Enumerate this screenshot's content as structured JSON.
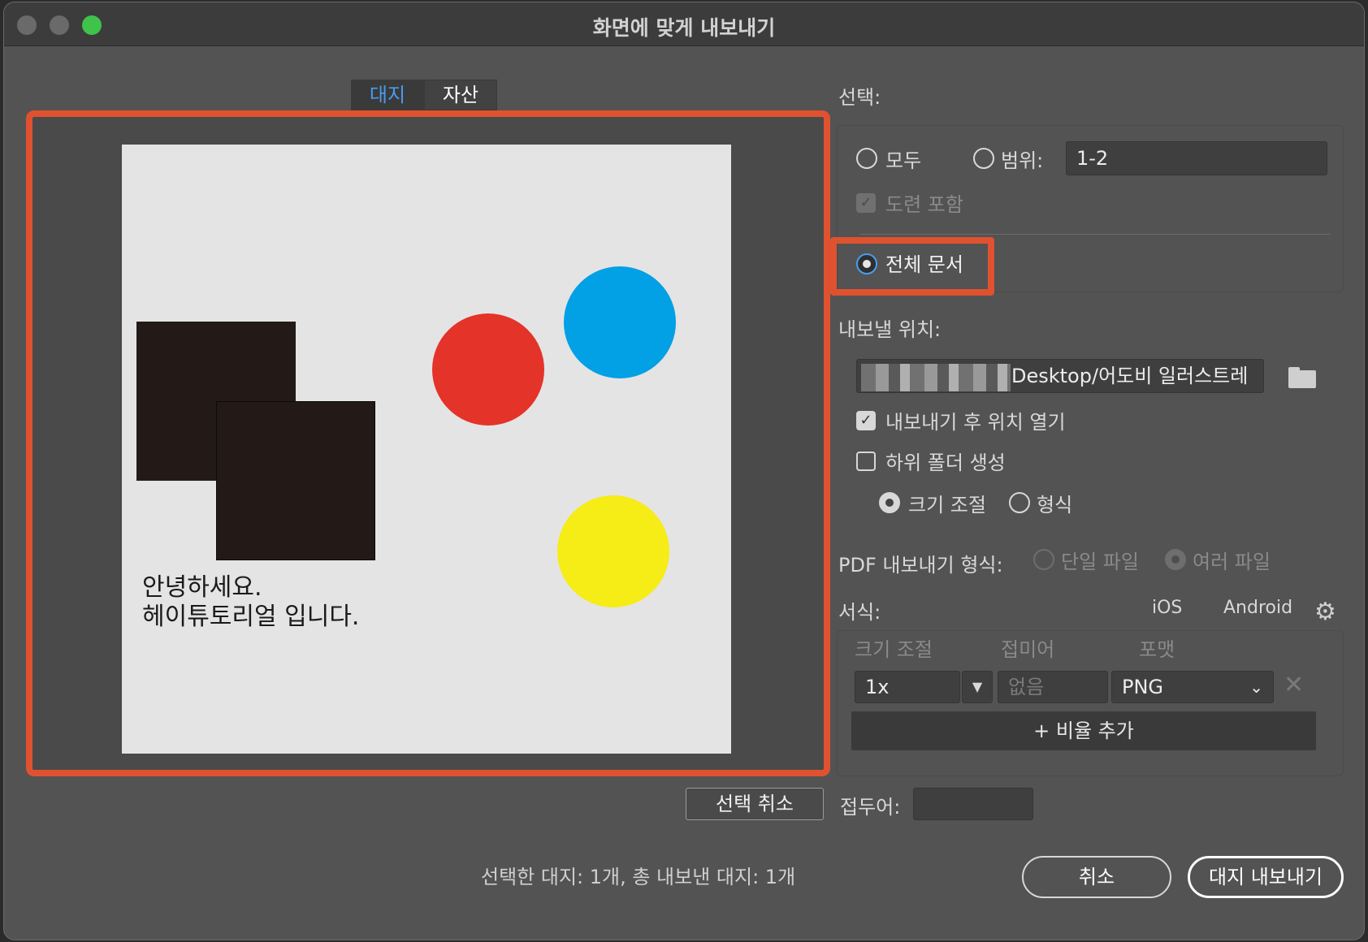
{
  "window": {
    "title": "화면에 맞게 내보내기"
  },
  "tabs": [
    {
      "label": "대지",
      "active": true
    },
    {
      "label": "자산",
      "active": false
    }
  ],
  "preview": {
    "artboard_text_line1": "안녕하세요.",
    "artboard_text_line2": "헤이튜토리얼 입니다.",
    "colors": {
      "red": "#e43329",
      "blue": "#02a0e5",
      "yellow": "#f6ec16",
      "dark": "#231a18",
      "highlight": "#e0522f"
    }
  },
  "selection": {
    "label": "선택:",
    "all_label": "모두",
    "range_label": "범위:",
    "range_value": "1-2",
    "include_bleed_label": "도련 포함",
    "full_document_label": "전체 문서",
    "selected_option": "full_document"
  },
  "export_location": {
    "label": "내보낼 위치:",
    "path": "Desktop/어도비 일러스트레"
  },
  "options": {
    "open_location_label": "내보내기 후 위치 열기",
    "open_location_checked": true,
    "create_subfolder_label": "하위 폴더 생성",
    "create_subfolder_checked": false,
    "scale_label": "크기 조절",
    "format_label": "형식",
    "scale_selected": true
  },
  "pdf": {
    "label": "PDF 내보내기 형식:",
    "single_label": "단일 파일",
    "multiple_label": "여러 파일"
  },
  "formats": {
    "label": "서식:",
    "ios_label": "iOS",
    "android_label": "Android",
    "headers": {
      "scale": "크기 조절",
      "suffix": "접미어",
      "format": "포맷"
    },
    "row": {
      "scale": "1x",
      "suffix_placeholder": "없음",
      "format": "PNG"
    },
    "add_scale_label": "+ 비율 추가"
  },
  "prefix": {
    "label": "접두어:",
    "value": ""
  },
  "footer": {
    "deselect_label": "선택 취소",
    "status": "선택한 대지: 1개, 총 내보낸 대지: 1개",
    "cancel_label": "취소",
    "export_label": "대지 내보내기"
  }
}
